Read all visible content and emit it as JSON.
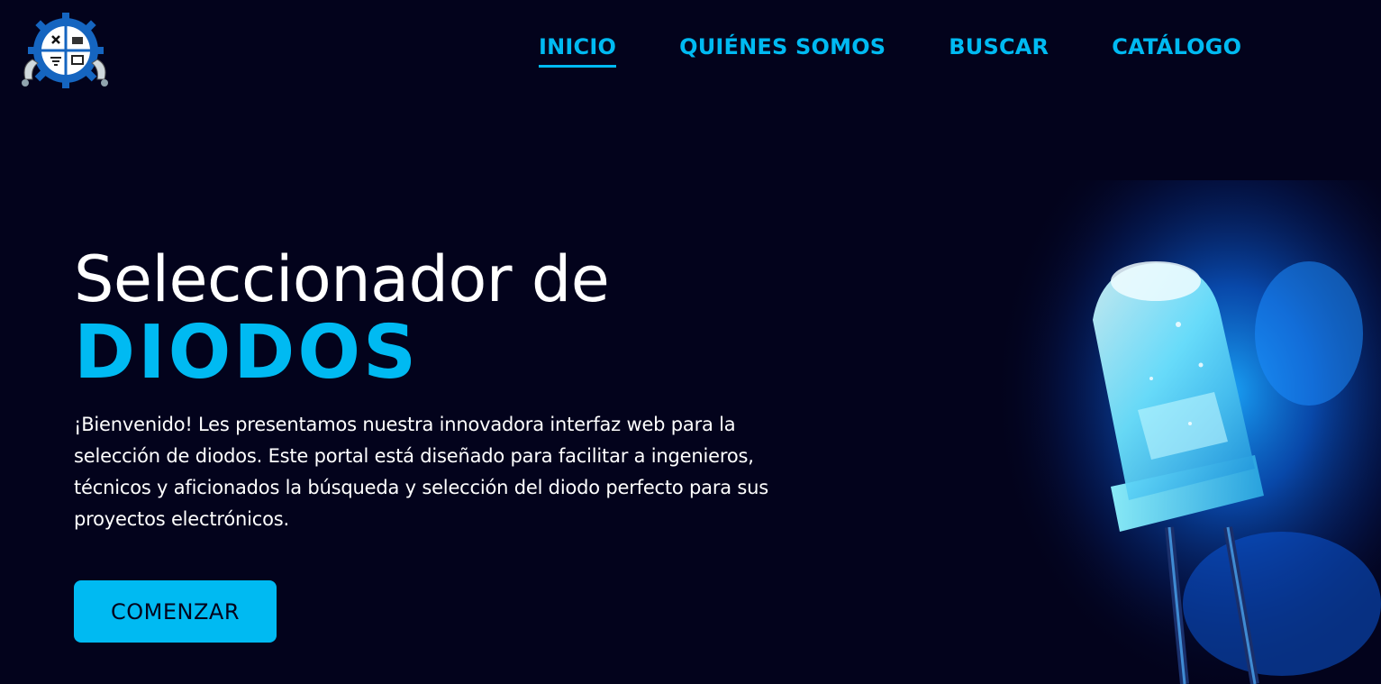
{
  "colors": {
    "background": "#03031c",
    "accent": "#00baf2",
    "text": "#ffffff",
    "button_text": "#03031c"
  },
  "logo": {
    "icon": "tools-gear-logo-icon"
  },
  "nav": {
    "items": [
      {
        "label": "INICIO",
        "active": true
      },
      {
        "label": "QUIÉNES SOMOS",
        "active": false
      },
      {
        "label": "BUSCAR",
        "active": false
      },
      {
        "label": "CATÁLOGO",
        "active": false
      }
    ]
  },
  "hero": {
    "title": "Seleccionador de",
    "accent_title": "DIODOS",
    "description": "¡Bienvenido! Les presentamos nuestra innovadora interfaz web para la selección de diodos. Este portal está diseñado para facilitar a ingenieros, técnicos y aficionados la búsqueda y selección del diodo perfecto para sus proyectos electrónicos.",
    "cta_label": "COMENZAR"
  },
  "image": {
    "icon": "blue-led-diode-icon"
  }
}
